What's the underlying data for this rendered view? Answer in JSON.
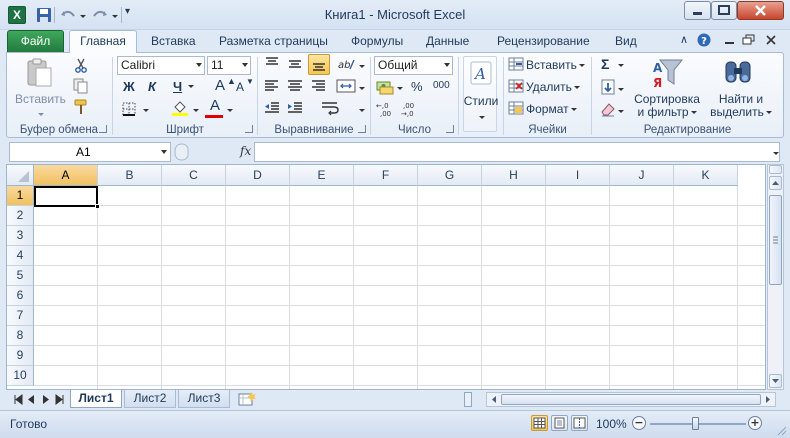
{
  "window": {
    "title": "Книга1  -  Microsoft Excel",
    "app_icon": "excel-icon",
    "app_icon_letter": "X"
  },
  "ribbon_tabs": [
    {
      "label": "Файл"
    },
    {
      "label": "Главная"
    },
    {
      "label": "Вставка"
    },
    {
      "label": "Разметка страницы"
    },
    {
      "label": "Формулы"
    },
    {
      "label": "Данные"
    },
    {
      "label": "Рецензирование"
    },
    {
      "label": "Вид"
    }
  ],
  "groups": {
    "clipboard": {
      "label": "Буфер обмена",
      "paste_label": "Вставить"
    },
    "font": {
      "label": "Шрифт",
      "font_name": "Calibri",
      "font_size": "11",
      "bold": "Ж",
      "italic": "К",
      "underline": "Ч",
      "grow": "A",
      "shrink": "A",
      "font_color_glyph": "A"
    },
    "alignment": {
      "label": "Выравнивание"
    },
    "number": {
      "label": "Число",
      "format": "Общий",
      "percent": "%",
      "thousands": "000"
    },
    "styles": {
      "label": "Стили"
    },
    "cells": {
      "label": "Ячейки",
      "insert": "Вставить",
      "delete": "Удалить",
      "format": "Формат"
    },
    "editing": {
      "label": "Редактирование",
      "sort_line1": "Сортировка",
      "sort_line2": "и фильтр",
      "find_line1": "Найти и",
      "find_line2": "выделить",
      "sigma": "Σ"
    }
  },
  "formula_bar": {
    "name_box": "A1",
    "fx": "fx",
    "formula": ""
  },
  "grid": {
    "columns": [
      "A",
      "B",
      "C",
      "D",
      "E",
      "F",
      "G",
      "H",
      "I",
      "J",
      "K"
    ],
    "rows": [
      "1",
      "2",
      "3",
      "4",
      "5",
      "6",
      "7",
      "8",
      "9",
      "10"
    ],
    "selected_cell": "A1"
  },
  "sheets": [
    {
      "label": "Лист1",
      "active": true
    },
    {
      "label": "Лист2",
      "active": false
    },
    {
      "label": "Лист3",
      "active": false
    }
  ],
  "status": {
    "text": "Готово",
    "zoom": "100%",
    "zoom_level": 1.0
  },
  "colors": {
    "file_tab": "#227a3e",
    "selection_header": "#f1c15f",
    "ribbon_bg": "#fbfcfe"
  }
}
